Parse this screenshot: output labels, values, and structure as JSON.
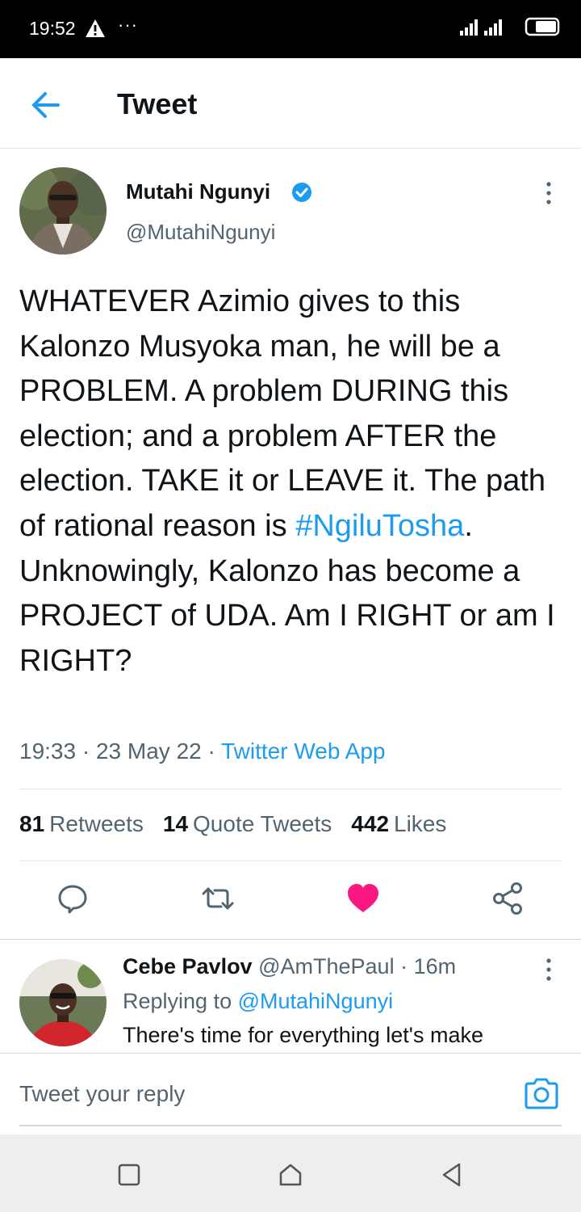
{
  "status_bar": {
    "time": "19:52",
    "dots": "···"
  },
  "header": {
    "title": "Tweet"
  },
  "tweet": {
    "author_name": "Mutahi Ngunyi",
    "author_handle": "@MutahiNgunyi",
    "text_before": "WHATEVER Azimio gives to this Kalonzo Musyoka man, he will be a PROBLEM. A problem DURING this election; and a problem AFTER the election. TAKE it or LEAVE it. The path of rational reason is ",
    "hashtag": "#NgiluTosha",
    "text_after": ". Unknowingly, Kalonzo has become a PROJECT of UDA.  Am I RIGHT or am I RIGHT?",
    "time": "19:33",
    "date": "23 May 22",
    "source": "Twitter Web App",
    "stats": {
      "retweets_count": "81",
      "retweets_label": "Retweets",
      "quotes_count": "14",
      "quotes_label": "Quote Tweets",
      "likes_count": "442",
      "likes_label": "Likes"
    }
  },
  "reply": {
    "name": "Cebe Pavlov",
    "handle": "@AmThePaul",
    "time": "16m",
    "replying_label": "Replying to",
    "replying_to": "@MutahiNgunyi",
    "text": "There's time for everything let's make"
  },
  "compose": {
    "placeholder": "Tweet your reply"
  },
  "colors": {
    "accent": "#1d9bf0",
    "like": "#f91880",
    "text": "#0f1419",
    "muted": "#536471"
  },
  "icons": [
    "warning-icon",
    "signal-icon",
    "battery-icon",
    "back-arrow-icon",
    "verified-icon",
    "more-icon",
    "reply-icon",
    "retweet-icon",
    "heart-icon",
    "share-icon",
    "camera-icon",
    "nav-square-icon",
    "nav-home-icon",
    "nav-back-icon"
  ]
}
